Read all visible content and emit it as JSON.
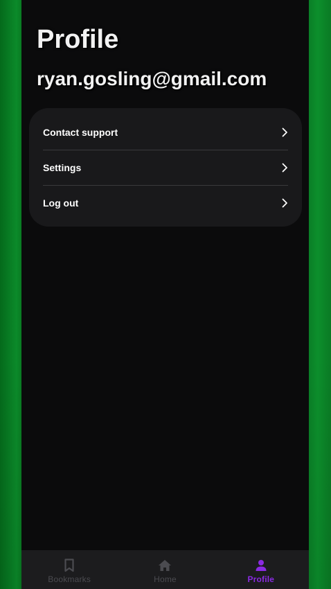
{
  "page": {
    "title": "Profile",
    "email": "ryan.gosling@gmail.com"
  },
  "menu": {
    "items": [
      {
        "label": "Contact support",
        "icon": "chevron-right-icon"
      },
      {
        "label": "Settings",
        "icon": "chevron-right-icon"
      },
      {
        "label": "Log out",
        "icon": "chevron-right-icon"
      }
    ]
  },
  "bottom_nav": {
    "items": [
      {
        "label": "Bookmarks",
        "icon": "bookmark-icon",
        "active": false
      },
      {
        "label": "Home",
        "icon": "home-icon",
        "active": false
      },
      {
        "label": "Profile",
        "icon": "person-icon",
        "active": true
      }
    ]
  },
  "colors": {
    "accent": "#8a2be2",
    "inactive": "#4b4b50",
    "card": "#19191b",
    "background": "#0b0b0c",
    "backdrop_green": "#0a7d26"
  }
}
